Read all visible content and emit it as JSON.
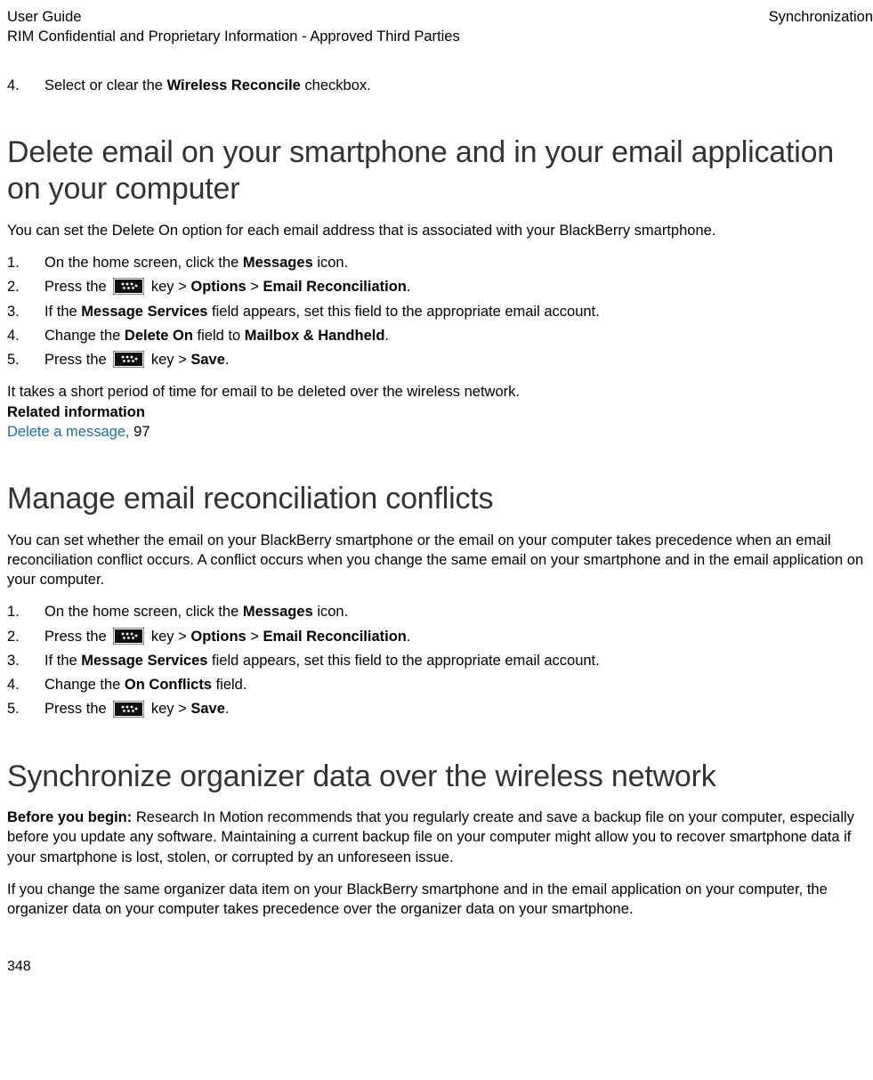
{
  "header": {
    "guide": "User Guide",
    "notice": "RIM Confidential and Proprietary Information - Approved Third Parties",
    "section": "Synchronization"
  },
  "pre_step": {
    "num": "4.",
    "prefix": "Select or clear the ",
    "bold": "Wireless Reconcile",
    "suffix": " checkbox."
  },
  "s1": {
    "title": "Delete email on your smartphone and in your email application on your computer",
    "intro": "You can set the Delete On option for each email address that is associated with your BlackBerry smartphone.",
    "steps": {
      "n1": "1.",
      "t1a": "On the home screen, click the ",
      "t1b": "Messages",
      "t1c": " icon.",
      "n2": "2.",
      "t2a": " Press the ",
      "t2b": " key > ",
      "t2c": "Options",
      "t2d": " > ",
      "t2e": "Email Reconciliation",
      "t2f": ".",
      "n3": "3.",
      "t3a": "If the ",
      "t3b": "Message Services",
      "t3c": " field appears, set this field to the appropriate email account.",
      "n4": "4.",
      "t4a": "Change the ",
      "t4b": "Delete On",
      "t4c": " field to ",
      "t4d": "Mailbox & Handheld",
      "t4e": ".",
      "n5": "5.",
      "t5a": " Press the ",
      "t5b": " key > ",
      "t5c": "Save",
      "t5d": "."
    },
    "after": "It takes a short period of time for email to be deleted over the wireless network.",
    "related_label": "Related information",
    "related_link": "Delete a message,",
    "related_page": " 97"
  },
  "s2": {
    "title": "Manage email reconciliation conflicts",
    "intro": "You can set whether the email on your BlackBerry smartphone or the email on your computer takes precedence when an email reconciliation conflict occurs. A conflict occurs when you change the same email on your smartphone and in the email application on your computer.",
    "steps": {
      "n1": "1.",
      "t1a": "On the home screen, click the ",
      "t1b": "Messages",
      "t1c": " icon.",
      "n2": "2.",
      "t2a": " Press the ",
      "t2b": " key > ",
      "t2c": "Options",
      "t2d": " > ",
      "t2e": "Email Reconciliation",
      "t2f": ".",
      "n3": "3.",
      "t3a": "If the ",
      "t3b": "Message Services",
      "t3c": " field appears, set this field to the appropriate email account.",
      "n4": "4.",
      "t4a": "Change the ",
      "t4b": "On Conflicts",
      "t4c": " field.",
      "n5": "5.",
      "t5a": " Press the ",
      "t5b": " key > ",
      "t5c": "Save",
      "t5d": "."
    }
  },
  "s3": {
    "title": "Synchronize organizer data over the wireless network",
    "before_label": "Before you begin: ",
    "before_text": "Research In Motion recommends that you regularly create and save a backup file on your computer, especially before you update any software. Maintaining a current backup file on your computer might allow you to recover smartphone data if your smartphone is lost, stolen, or corrupted by an unforeseen issue.",
    "para2": "If you change the same organizer data item on your BlackBerry smartphone and in the email application on your computer, the organizer data on your computer takes precedence over the organizer data on your smartphone."
  },
  "page_number": "348"
}
